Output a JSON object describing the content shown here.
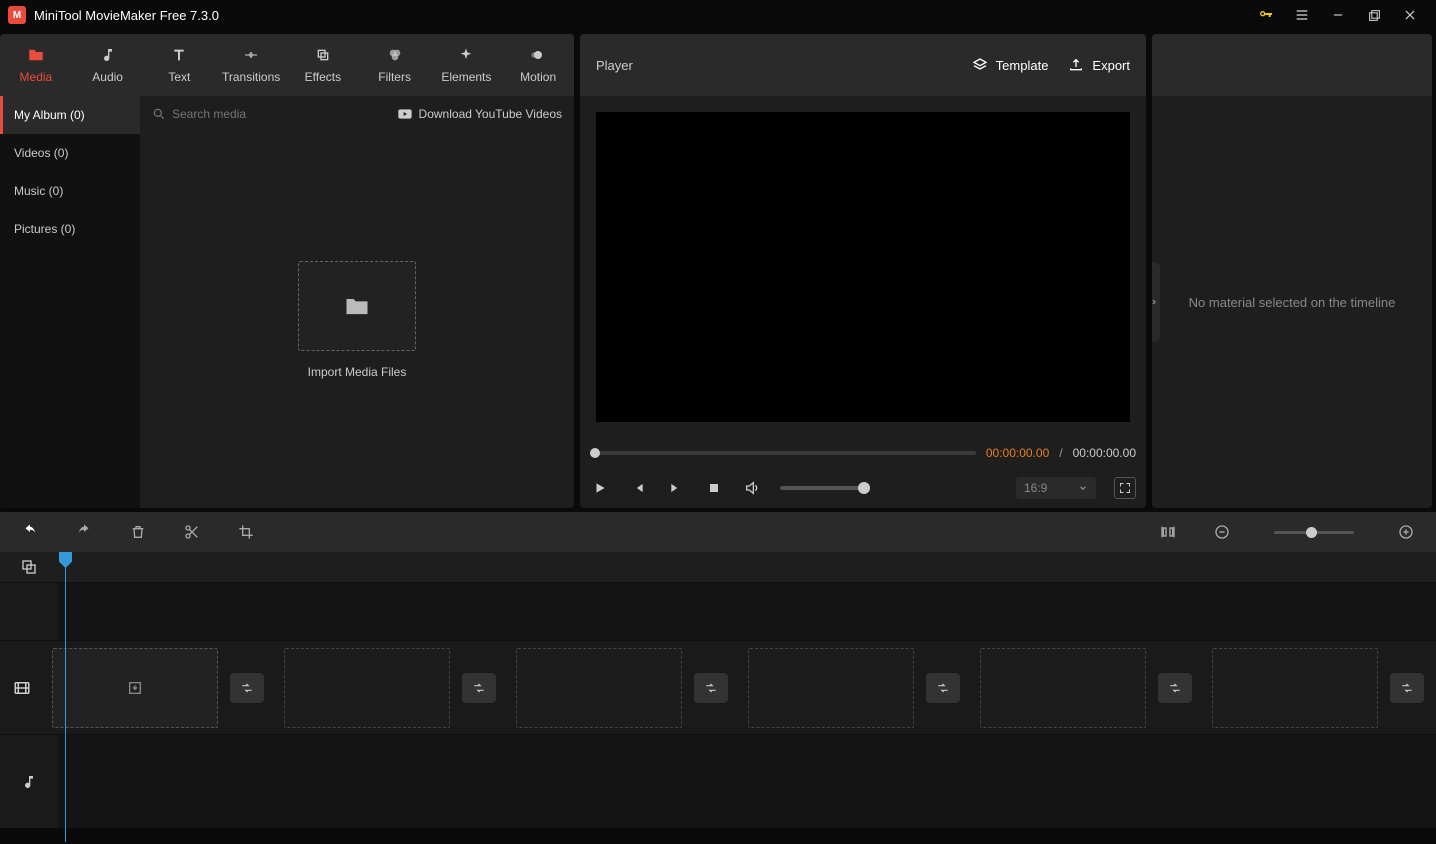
{
  "app": {
    "title": "MiniTool MovieMaker Free 7.3.0"
  },
  "tabs": [
    {
      "label": "Media"
    },
    {
      "label": "Audio"
    },
    {
      "label": "Text"
    },
    {
      "label": "Transitions"
    },
    {
      "label": "Effects"
    },
    {
      "label": "Filters"
    },
    {
      "label": "Elements"
    },
    {
      "label": "Motion"
    }
  ],
  "sidebar": [
    {
      "label": "My Album (0)"
    },
    {
      "label": "Videos (0)"
    },
    {
      "label": "Music (0)"
    },
    {
      "label": "Pictures (0)"
    }
  ],
  "search": {
    "placeholder": "Search media"
  },
  "download_link": "Download YouTube Videos",
  "import_label": "Import Media Files",
  "player": {
    "title": "Player",
    "template": "Template",
    "export": "Export",
    "time_current": "00:00:00.00",
    "time_sep": "/",
    "time_total": "00:00:00.00",
    "aspect": "16:9"
  },
  "props": {
    "empty": "No material selected on the timeline"
  }
}
